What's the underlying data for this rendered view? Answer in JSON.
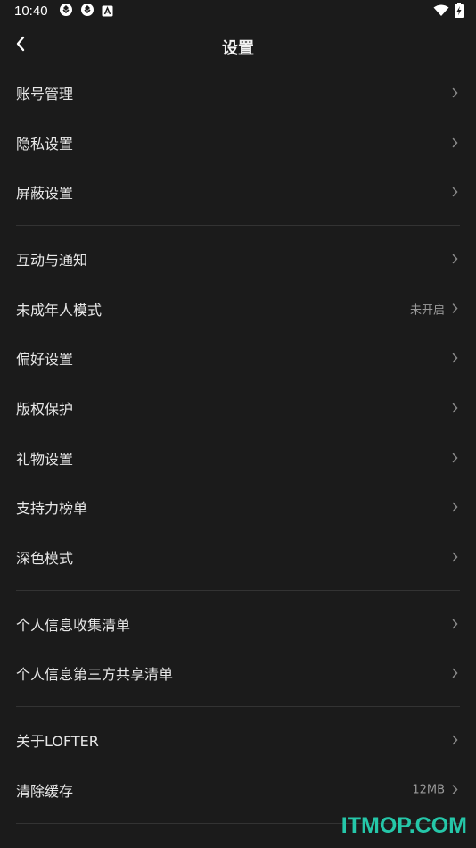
{
  "status_bar": {
    "time": "10:40",
    "left_icons": [
      "aperture-icon",
      "aperture-icon",
      "notification-a-icon"
    ],
    "right_icons": [
      "wifi-icon",
      "battery-charging-icon"
    ]
  },
  "header": {
    "title": "设置",
    "back_icon": "chevron-left-icon"
  },
  "groups": [
    {
      "items": [
        {
          "label": "账号管理",
          "value": ""
        },
        {
          "label": "隐私设置",
          "value": ""
        },
        {
          "label": "屏蔽设置",
          "value": ""
        }
      ]
    },
    {
      "items": [
        {
          "label": "互动与通知",
          "value": ""
        },
        {
          "label": "未成年人模式",
          "value": "未开启"
        },
        {
          "label": "偏好设置",
          "value": ""
        },
        {
          "label": "版权保护",
          "value": ""
        },
        {
          "label": "礼物设置",
          "value": ""
        },
        {
          "label": "支持力榜单",
          "value": ""
        },
        {
          "label": "深色模式",
          "value": ""
        }
      ]
    },
    {
      "items": [
        {
          "label": "个人信息收集清单",
          "value": ""
        },
        {
          "label": "个人信息第三方共享清单",
          "value": ""
        }
      ]
    },
    {
      "items": [
        {
          "label": "关于LOFTER",
          "value": ""
        },
        {
          "label": "清除缓存",
          "value": "12MB"
        }
      ]
    }
  ],
  "watermark": "ITMOP.COM",
  "colors": {
    "background": "#1b1b1b",
    "text": "#e8e8e8",
    "secondary_text": "#9a9a9a",
    "divider": "#333333",
    "watermark": "#25c7a9"
  }
}
